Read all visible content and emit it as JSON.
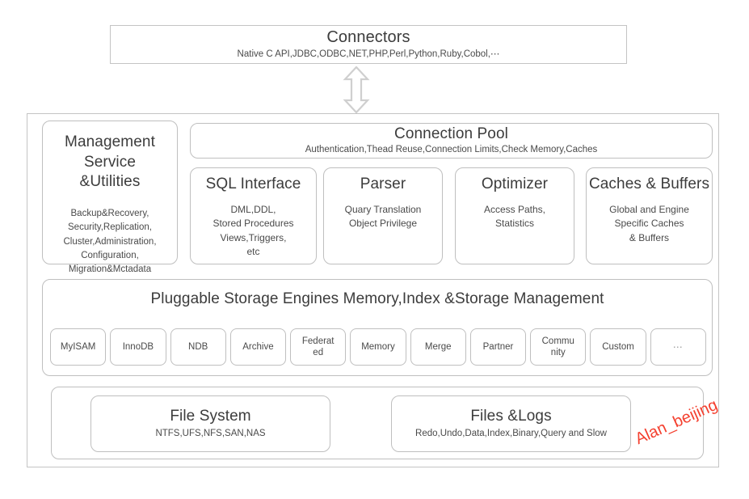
{
  "connectors": {
    "title": "Connectors",
    "subtitle": "Native C API,JDBC,ODBC,NET,PHP,Perl,Python,Ruby,Cobol,⋯"
  },
  "arrow": {
    "name": "double-headed-vertical-arrow",
    "color": "#cfcfcf"
  },
  "management": {
    "title": "Management\nService\n&Utilities",
    "title_lines": [
      "Management",
      "Service",
      "&Utilities"
    ],
    "details": "Backup&Recovery,\nSecurity,Replication,\nCluster,Administration,\nConfiguration,\nMigration&Mctadata",
    "detail_lines": [
      "Backup&Recovery,",
      "Security,Replication,",
      "Cluster,Administration,",
      "Configuration,",
      "Migration&Mctadata"
    ]
  },
  "connection_pool": {
    "title": "Connection Pool",
    "subtitle": "Authentication,Thead Reuse,Connection Limits,Check Memory,Caches"
  },
  "modules": [
    {
      "id": "sql-interface",
      "title": "SQL Interface",
      "details": "DML,DDL,\nStored Procedures\nViews,Triggers,\netc"
    },
    {
      "id": "parser",
      "title": "Parser",
      "details": "Quary Translation\nObject Privilege"
    },
    {
      "id": "optimizer",
      "title": "Optimizer",
      "details": "Access Paths,\nStatistics"
    },
    {
      "id": "caches-buffers",
      "title": "Caches & Buffers",
      "details": "Global and Engine\nSpecific Caches\n& Buffers"
    }
  ],
  "storage": {
    "title": "Pluggable Storage Engines Memory,Index &Storage Management",
    "engines": [
      "MyISAM",
      "InnoDB",
      "NDB",
      "Archive",
      "Federat\ned",
      "Memory",
      "Merge",
      "Partner",
      "Commu\nnity",
      "Custom",
      "⋯"
    ]
  },
  "file_row": [
    {
      "id": "file-system",
      "title": "File System",
      "subtitle": "NTFS,UFS,NFS,SAN,NAS"
    },
    {
      "id": "files-logs",
      "title": "Files &Logs",
      "subtitle": "Redo,Undo,Data,Index,Binary,Query and Slow"
    }
  ],
  "watermark": {
    "text": "Alan_beijing",
    "color": "#f4402f"
  },
  "colors": {
    "border": "#bfbfbf",
    "outer_border": "#c4c4c4",
    "text": "#3c3c3c",
    "subtext": "#4a4a4a",
    "background": "#ffffff",
    "arrow": "#cfcfcf",
    "accent_red": "#f4402f"
  }
}
